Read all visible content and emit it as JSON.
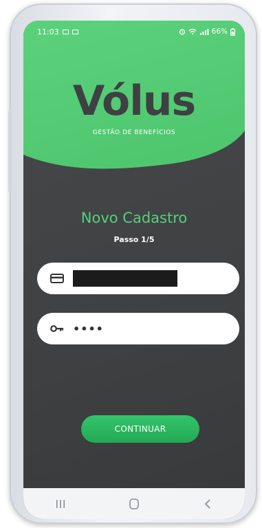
{
  "status_bar": {
    "time": "11:03",
    "battery": "66%"
  },
  "brand": {
    "logo": "Vólus",
    "tagline": "GESTÃO DE BENEFÍCIOS"
  },
  "page": {
    "title": "Novo Cadastro",
    "step": "Passo 1/5"
  },
  "form": {
    "card_field": {
      "icon": "card-icon",
      "value": ""
    },
    "password_field": {
      "icon": "key-icon",
      "value": "••••"
    }
  },
  "actions": {
    "continue_label": "CONTINUAR"
  },
  "nav": {
    "recents_icon": "recents-icon",
    "home_icon": "home-icon",
    "back_icon": "back-icon"
  },
  "colors": {
    "brand_green": "#56d07a",
    "button_green": "#2bb760",
    "background_dark": "#3f4143"
  }
}
